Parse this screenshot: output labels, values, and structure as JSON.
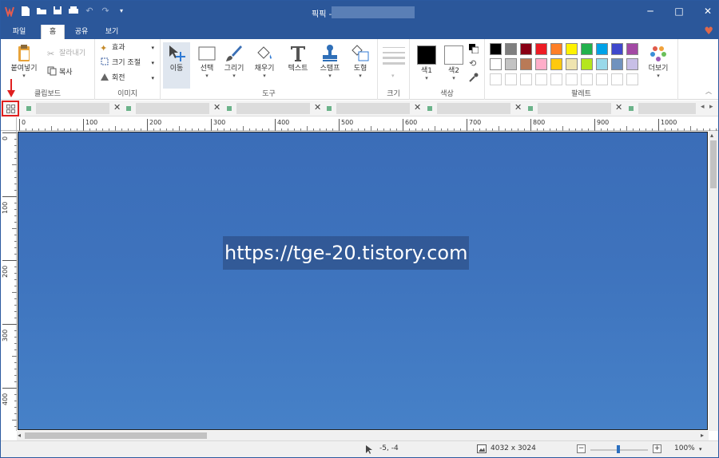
{
  "window": {
    "title": "픽픽 -",
    "controls": [
      "minimize",
      "maximize",
      "close"
    ]
  },
  "tabs": [
    {
      "label": "파일",
      "active": false
    },
    {
      "label": "홈",
      "active": true
    },
    {
      "label": "공유",
      "active": false
    },
    {
      "label": "보기",
      "active": false
    }
  ],
  "ribbon": {
    "clipboard": {
      "group_label": "클립보드",
      "paste": "붙여넣기",
      "cut": "잘라내기",
      "copy": "복사"
    },
    "image": {
      "group_label": "이미지",
      "effects": "효과",
      "resize": "크기 조절",
      "rotate": "회전"
    },
    "tools": {
      "group_label": "도구",
      "move": "이동",
      "select": "선택",
      "draw": "그리기",
      "fill": "채우기",
      "text": "텍스트",
      "stamp": "스탬프",
      "shape": "도형"
    },
    "size": {
      "group_label": "크기"
    },
    "color": {
      "group_label": "색상",
      "color1": "색1",
      "color2": "색2"
    },
    "palette": {
      "group_label": "팔레트",
      "more": "더보기",
      "row1": [
        "#000000",
        "#7f7f7f",
        "#880015",
        "#ed1c24",
        "#ff7f27",
        "#fff200",
        "#22b14c",
        "#00a2e8",
        "#3f48cc",
        "#a349a4"
      ],
      "row2": [
        "#ffffff",
        "#c3c3c3",
        "#b97a57",
        "#ffaec9",
        "#ffc90e",
        "#efe4b0",
        "#b5e61d",
        "#99d9ea",
        "#7092be",
        "#c8bfe7"
      ]
    }
  },
  "ruler": {
    "horizontal": [
      "0",
      "100",
      "200",
      "300",
      "400",
      "500",
      "600",
      "700",
      "800",
      "900",
      "1000"
    ],
    "vertical": [
      "0",
      "100",
      "200",
      "300",
      "400"
    ]
  },
  "canvas": {
    "watermark": "https://tge-20.tistory.com"
  },
  "status": {
    "cursor_pos": "-5, -4",
    "image_size": "4032 x 3024",
    "zoom": "100%"
  }
}
